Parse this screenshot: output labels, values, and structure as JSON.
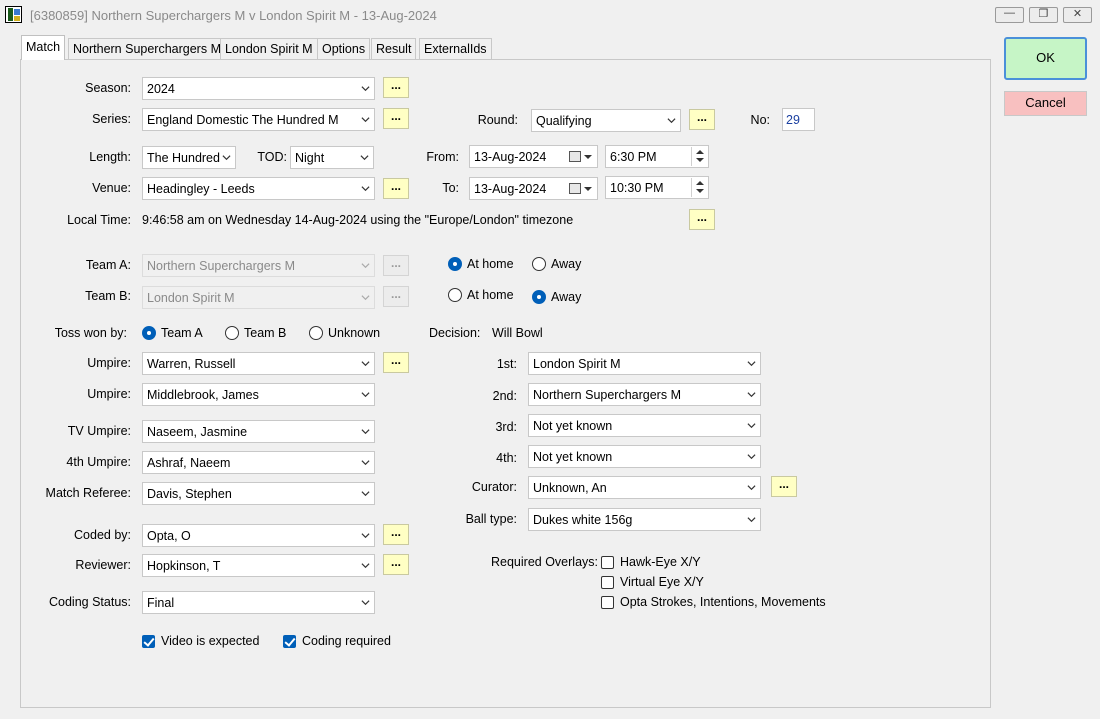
{
  "window": {
    "title": "[6380859] Northern Superchargers M v London Spirit M - 13-Aug-2024"
  },
  "tabs": [
    "Match",
    "Northern Superchargers M",
    "London Spirit M",
    "Options",
    "Result",
    "ExternalIds"
  ],
  "buttons": {
    "ok": "OK",
    "cancel": "Cancel",
    "ellipsis": "..."
  },
  "labels": {
    "season": "Season:",
    "series": "Series:",
    "round": "Round:",
    "no": "No:",
    "length": "Length:",
    "tod": "TOD:",
    "from": "From:",
    "to": "To:",
    "venue": "Venue:",
    "local_time": "Local Time:",
    "team_a": "Team A:",
    "team_b": "Team B:",
    "toss_won_by": "Toss won by:",
    "decision": "Decision:",
    "umpire1": "Umpire:",
    "umpire2": "Umpire:",
    "tv_umpire": "TV Umpire:",
    "fourth_umpire": "4th Umpire:",
    "match_referee": "Match Referee:",
    "coded_by": "Coded by:",
    "reviewer": "Reviewer:",
    "coding_status": "Coding Status:",
    "first": "1st:",
    "second": "2nd:",
    "third": "3rd:",
    "fourth": "4th:",
    "curator": "Curator:",
    "ball_type": "Ball type:",
    "required_overlays": "Required Overlays:"
  },
  "fields": {
    "season": "2024",
    "series": "England Domestic The Hundred M",
    "round": "Qualifying",
    "no": "29",
    "length": "The Hundred",
    "tod": "Night",
    "from_date": "13-Aug-2024",
    "from_time": "6:30 PM",
    "to_date": "13-Aug-2024",
    "to_time": "10:30 PM",
    "venue": "Headingley - Leeds",
    "local_time": "9:46:58 am on Wednesday 14-Aug-2024 using the \"Europe/London\" timezone",
    "team_a": "Northern Superchargers M",
    "team_b": "London Spirit M",
    "decision": "Will Bowl",
    "umpire1": "Warren, Russell",
    "umpire2": "Middlebrook, James",
    "tv_umpire": "Naseem, Jasmine",
    "fourth_umpire": "Ashraf, Naeem",
    "match_referee": "Davis, Stephen",
    "coded_by": "Opta, O",
    "reviewer": "Hopkinson, T",
    "coding_status": "Final",
    "first": "London Spirit M",
    "second": "Northern Superchargers M",
    "third": "Not yet known",
    "fourth": "Not yet known",
    "curator": "Unknown, An",
    "ball_type": "Dukes white 156g"
  },
  "options": {
    "at_home": "At home",
    "away": "Away",
    "team_a_home": true,
    "team_b_home": false,
    "toss_team_a": "Team A",
    "toss_team_b": "Team B",
    "toss_unknown": "Unknown",
    "toss_selected": "Team A",
    "hawkeye": "Hawk-Eye X/Y",
    "virtual_eye": "Virtual Eye X/Y",
    "opta_strokes": "Opta Strokes, Intentions, Movements",
    "video_expected": "Video is expected",
    "coding_required": "Coding required",
    "video_expected_checked": true,
    "coding_required_checked": true,
    "hawkeye_checked": false,
    "virtual_eye_checked": false,
    "opta_strokes_checked": false
  },
  "colors": {
    "accent": "#005fb8",
    "ok_bg": "#c6f5c6",
    "cancel_bg": "#f8c0c0",
    "ellipsis_bg": "#ffffc4"
  }
}
